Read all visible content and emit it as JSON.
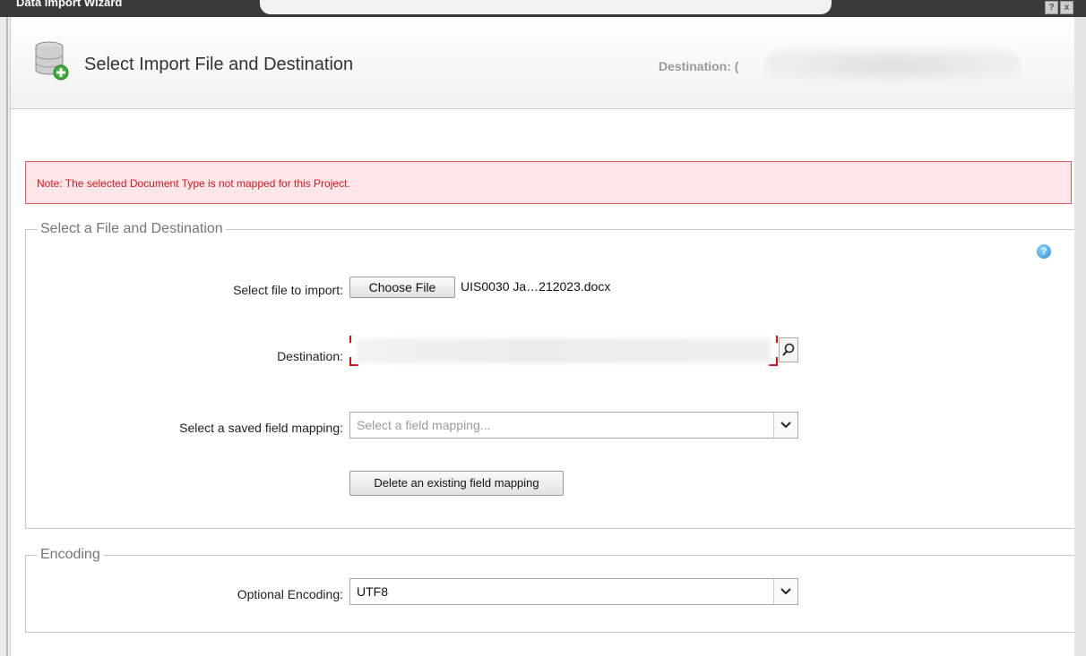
{
  "window": {
    "title": "Data Import Wizard",
    "help_glyph": "?",
    "close_glyph": "x"
  },
  "header": {
    "heading": "Select Import File and Destination",
    "destination_label": "Destination: (",
    "icon": "database-add-icon"
  },
  "note": {
    "text": "Note: The selected Document Type is not mapped for this Project."
  },
  "file_section": {
    "legend": "Select a File and Destination",
    "help_icon": "help-icon",
    "file_label": "Select file to import:",
    "choose_file_label": "Choose File",
    "file_name": "UIS0030 Ja…212023.docx",
    "destination_label": "Destination:",
    "mapping_label": "Select a saved field mapping:",
    "mapping_placeholder": "Select a field mapping...",
    "delete_mapping_label": "Delete an existing field mapping"
  },
  "encoding_section": {
    "legend": "Encoding",
    "encoding_label": "Optional Encoding:",
    "encoding_value": "UTF8"
  },
  "colors": {
    "note_text": "#e0141e",
    "note_bg": "#ffe6e8",
    "note_border": "#e25a5a",
    "help_icon": "#2a8fd6"
  }
}
